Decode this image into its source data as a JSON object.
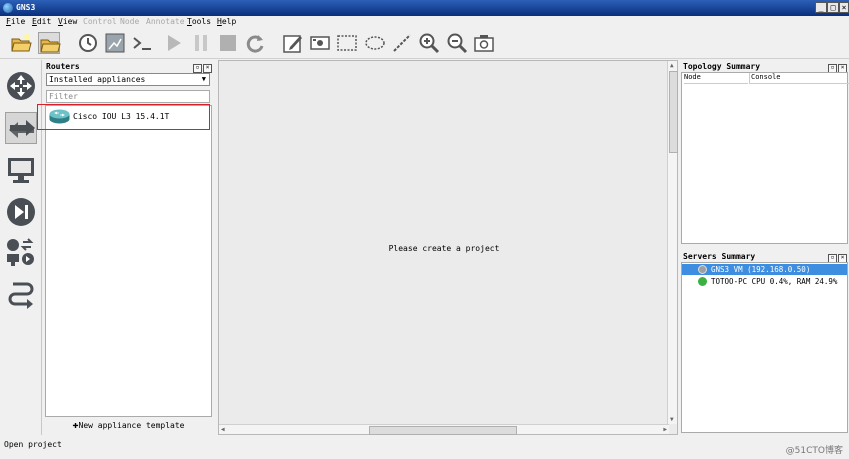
{
  "window": {
    "title": "GNS3",
    "min_label": "_",
    "max_label": "□",
    "close_label": "×"
  },
  "menu": [
    {
      "label": "File",
      "enabled": true
    },
    {
      "label": "Edit",
      "enabled": true
    },
    {
      "label": "View",
      "enabled": true
    },
    {
      "label": "Control",
      "enabled": false
    },
    {
      "label": "Node",
      "enabled": false
    },
    {
      "label": "Annotate",
      "enabled": false
    },
    {
      "label": "Tools",
      "enabled": true
    },
    {
      "label": "Help",
      "enabled": true
    }
  ],
  "toolbar": [
    "new-project-icon",
    "open-project-icon",
    "snapshot-clock-icon",
    "show-interface-labels-icon",
    "console-all-icon",
    "start-all-icon",
    "suspend-all-icon",
    "stop-all-icon",
    "reload-all-icon",
    "add-note-icon",
    "insert-picture-icon",
    "draw-rectangle-icon",
    "draw-ellipse-icon",
    "draw-line-icon",
    "zoom-in-icon",
    "zoom-out-icon",
    "screenshot-icon"
  ],
  "leftbar": [
    "browse-routers-icon",
    "browse-switches-icon",
    "browse-end-devices-icon",
    "browse-security-devices-icon",
    "browse-all-devices-icon",
    "add-link-icon"
  ],
  "routers": {
    "title": "Routers",
    "dropdown_value": "Installed appliances",
    "filter_placeholder": "Filter",
    "items": [
      {
        "label": "Cisco IOU L3 15.4.1T"
      }
    ],
    "new_template_label": "New appliance template"
  },
  "canvas": {
    "message": "Please create a project"
  },
  "topology": {
    "title": "Topology Summary",
    "col_node": "Node",
    "col_console": "Console"
  },
  "servers": {
    "title": "Servers Summary",
    "rows": [
      {
        "label": "GNS3 VM (192.168.0.50)",
        "status_color": "#9aa0a6",
        "selected": true
      },
      {
        "label": "TOTOO-PC CPU 0.4%, RAM 24.9%",
        "status_color": "#3cb043",
        "selected": false
      }
    ]
  },
  "status": {
    "text": "Open project"
  },
  "watermark": "@51CTO博客",
  "colors": {
    "title_bar": "#0a2f7c",
    "selection": "#3d8ee0",
    "highlight_box": "#d8202a"
  }
}
